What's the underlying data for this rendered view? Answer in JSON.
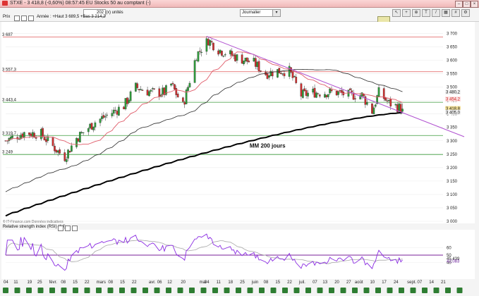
{
  "window": {
    "title": "STXE - 3 418,8 (-0,60%) 08:57:45 EU Stocks 50 au comptant (-)",
    "min": "–",
    "max": "□",
    "close": "×"
  },
  "toolbar": {
    "range_value": "202",
    "units_label": "(x) unités",
    "period_value": "Journalier",
    "icons": [
      "cursor-icon",
      "crosshair-icon",
      "zoom-in-icon",
      "zoom-out-icon",
      "text-icon",
      "line-icon",
      "fibonacci-icon",
      "layout-icon",
      "grid-icon",
      "settings-icon"
    ]
  },
  "colors": {
    "candle_up": "#2e9b3a",
    "candle_down": "#cc2f2f",
    "ma_red": "#e05c6a",
    "ma_black": "#2b2b2b",
    "ma200": "#000000",
    "trendline": "#b050d0",
    "hline_red": "#e05a5a",
    "hline_green": "#3a9a3a",
    "rsi": "#8a2be2",
    "rsi_avg": "#a8a8a8",
    "rsi_level": "#7a1f9a"
  },
  "chart_data": [
    {
      "type": "candlestick",
      "panel_label": "Prix",
      "legend": "Année : +Haut 3 689,5 +Bas 3 214,2",
      "source": "© IT-Finance.com Données indicatives",
      "annotation": "MM 200 jours",
      "ylim": [
        3000,
        3730
      ],
      "yticks": [
        3000,
        3050,
        3100,
        3150,
        3200,
        3250,
        3300,
        3350,
        3400,
        3450,
        3500,
        3550,
        3600,
        3650,
        3700
      ],
      "hlines": [
        {
          "label": "3 687",
          "value": 3687,
          "color": "red"
        },
        {
          "label": "3 557,3",
          "value": 3557.3,
          "color": "red"
        },
        {
          "label": "3 443,4",
          "value": 3443.4,
          "color": "green"
        },
        {
          "label": "3 319,7",
          "value": 3319.7,
          "color": "green"
        },
        {
          "label": "3 249",
          "value": 3249,
          "color": "green"
        }
      ],
      "trendline": [
        {
          "date": "2015-05-04",
          "value": 3689.5
        },
        {
          "date": "2015-09-03",
          "value": 3390
        }
      ],
      "value_tags": [
        {
          "text": "3 480,2",
          "value": 3480.2
        },
        {
          "text": "3 454,2",
          "value": 3454.2
        },
        {
          "text": "3 418,8",
          "value": 3418.8
        },
        {
          "text": "3 405,0",
          "value": 3405.0
        }
      ],
      "ma200_range": {
        "start": 3020,
        "end": 3405
      },
      "ma_black_range": {
        "start": 3110,
        "end": 3480
      },
      "ohlc_anchors": [
        {
          "date": "2015-01-05",
          "close": 3300
        },
        {
          "date": "2015-01-16",
          "close": 3330
        },
        {
          "date": "2015-01-26",
          "close": 3325
        },
        {
          "date": "2015-02-05",
          "close": 3260
        },
        {
          "date": "2015-02-09",
          "close": 3240
        },
        {
          "date": "2015-02-16",
          "close": 3310
        },
        {
          "date": "2015-02-27",
          "close": 3370
        },
        {
          "date": "2015-03-16",
          "close": 3430
        },
        {
          "date": "2015-03-23",
          "close": 3500
        },
        {
          "date": "2015-04-01",
          "close": 3480
        },
        {
          "date": "2015-04-09",
          "close": 3480
        },
        {
          "date": "2015-04-13",
          "close": 3510
        },
        {
          "date": "2015-04-20",
          "close": 3430
        },
        {
          "date": "2015-04-28",
          "close": 3620
        },
        {
          "date": "2015-05-05",
          "close": 3675
        },
        {
          "date": "2015-05-11",
          "close": 3640
        },
        {
          "date": "2015-05-22",
          "close": 3610
        },
        {
          "date": "2015-06-01",
          "close": 3590
        },
        {
          "date": "2015-06-08",
          "close": 3550
        },
        {
          "date": "2015-06-15",
          "close": 3560
        },
        {
          "date": "2015-06-22",
          "close": 3560
        },
        {
          "date": "2015-06-29",
          "close": 3470
        },
        {
          "date": "2015-07-06",
          "close": 3480
        },
        {
          "date": "2015-07-13",
          "close": 3480
        },
        {
          "date": "2015-07-20",
          "close": 3480
        },
        {
          "date": "2015-07-27",
          "close": 3470
        },
        {
          "date": "2015-08-04",
          "close": 3470
        },
        {
          "date": "2015-08-10",
          "close": 3410
        },
        {
          "date": "2015-08-14",
          "close": 3480
        },
        {
          "date": "2015-08-20",
          "close": 3440
        },
        {
          "date": "2015-08-28",
          "close": 3418.8
        }
      ]
    },
    {
      "type": "line",
      "panel_label": "Relative strength index (RSI) (14)",
      "ylim": [
        20,
        80
      ],
      "level": 50,
      "tags": [
        {
          "text": "45,439",
          "value": 45.439
        },
        {
          "text": "42,083",
          "value": 42.083
        }
      ],
      "tick_marks": [
        "60",
        "50",
        "40"
      ]
    }
  ],
  "xaxis": {
    "labels": [
      {
        "text": "04",
        "date": "2015-01-05"
      },
      {
        "text": "11",
        "date": "2015-01-11"
      },
      {
        "text": "19",
        "date": "2015-01-19"
      },
      {
        "text": "25",
        "date": "2015-01-25"
      },
      {
        "text": "févr.",
        "date": "2015-02-01"
      },
      {
        "text": "08",
        "date": "2015-02-08"
      },
      {
        "text": "15",
        "date": "2015-02-15"
      },
      {
        "text": "22",
        "date": "2015-02-22"
      },
      {
        "text": "mars",
        "date": "2015-03-01"
      },
      {
        "text": "08",
        "date": "2015-03-08"
      },
      {
        "text": "15",
        "date": "2015-03-15"
      },
      {
        "text": "22",
        "date": "2015-03-22"
      },
      {
        "text": "avr.",
        "date": "2015-04-01"
      },
      {
        "text": "06",
        "date": "2015-04-06"
      },
      {
        "text": "12",
        "date": "2015-04-12"
      },
      {
        "text": "20",
        "date": "2015-04-20"
      },
      {
        "text": "mai",
        "date": "2015-05-01"
      },
      {
        "text": "04",
        "date": "2015-05-04"
      },
      {
        "text": "11",
        "date": "2015-05-11"
      },
      {
        "text": "18",
        "date": "2015-05-18"
      },
      {
        "text": "25",
        "date": "2015-05-25"
      },
      {
        "text": "juin",
        "date": "2015-06-01"
      },
      {
        "text": "08",
        "date": "2015-06-08"
      },
      {
        "text": "15",
        "date": "2015-06-15"
      },
      {
        "text": "22",
        "date": "2015-06-22"
      },
      {
        "text": "juil.",
        "date": "2015-06-29"
      },
      {
        "text": "07",
        "date": "2015-07-07"
      },
      {
        "text": "13",
        "date": "2015-07-13"
      },
      {
        "text": "20",
        "date": "2015-07-20"
      },
      {
        "text": "27",
        "date": "2015-07-27"
      },
      {
        "text": "août",
        "date": "2015-08-01"
      },
      {
        "text": "10",
        "date": "2015-08-10"
      },
      {
        "text": "17",
        "date": "2015-08-17"
      },
      {
        "text": "24",
        "date": "2015-08-24"
      },
      {
        "text": "sept.",
        "date": "2015-09-01"
      },
      {
        "text": "07",
        "date": "2015-09-07"
      },
      {
        "text": "14",
        "date": "2015-09-14"
      },
      {
        "text": "21",
        "date": "2015-09-21"
      }
    ]
  }
}
